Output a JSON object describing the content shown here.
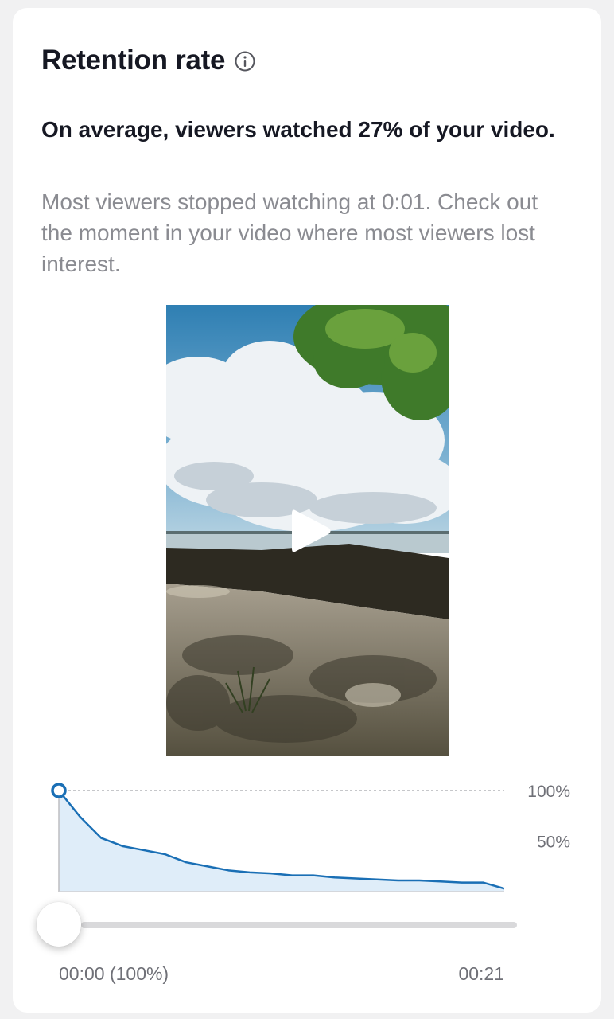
{
  "card": {
    "title": "Retention rate",
    "info_icon": "info-circle-icon",
    "headline": "On average, viewers watched 27% of your video.",
    "description": "Most viewers stopped watching at 0:01. Check out the moment in your video where most viewers lost interest."
  },
  "video": {
    "play_icon": "play-icon"
  },
  "chart_data": {
    "type": "area",
    "title": "",
    "xlabel": "",
    "ylabel": "",
    "x": [
      0,
      1,
      2,
      3,
      4,
      5,
      6,
      7,
      8,
      9,
      10,
      11,
      12,
      13,
      14,
      15,
      16,
      17,
      18,
      19,
      20,
      21
    ],
    "values": [
      100,
      74,
      53,
      45,
      41,
      37,
      29,
      25,
      21,
      19,
      18,
      16,
      16,
      14,
      13,
      12,
      11,
      11,
      10,
      9,
      9,
      3
    ],
    "ylim": [
      0,
      100
    ],
    "y_ticks": [
      "100%",
      "50%"
    ],
    "y_tick_values": [
      100,
      50
    ],
    "gridlines": "dashed",
    "line_color": "#1a6fb5",
    "fill_color": "#dcebf8",
    "marker_color": "#1a6fb5"
  },
  "slider": {
    "value": 0,
    "start_label": "00:00 (100%)",
    "end_label": "00:21"
  }
}
